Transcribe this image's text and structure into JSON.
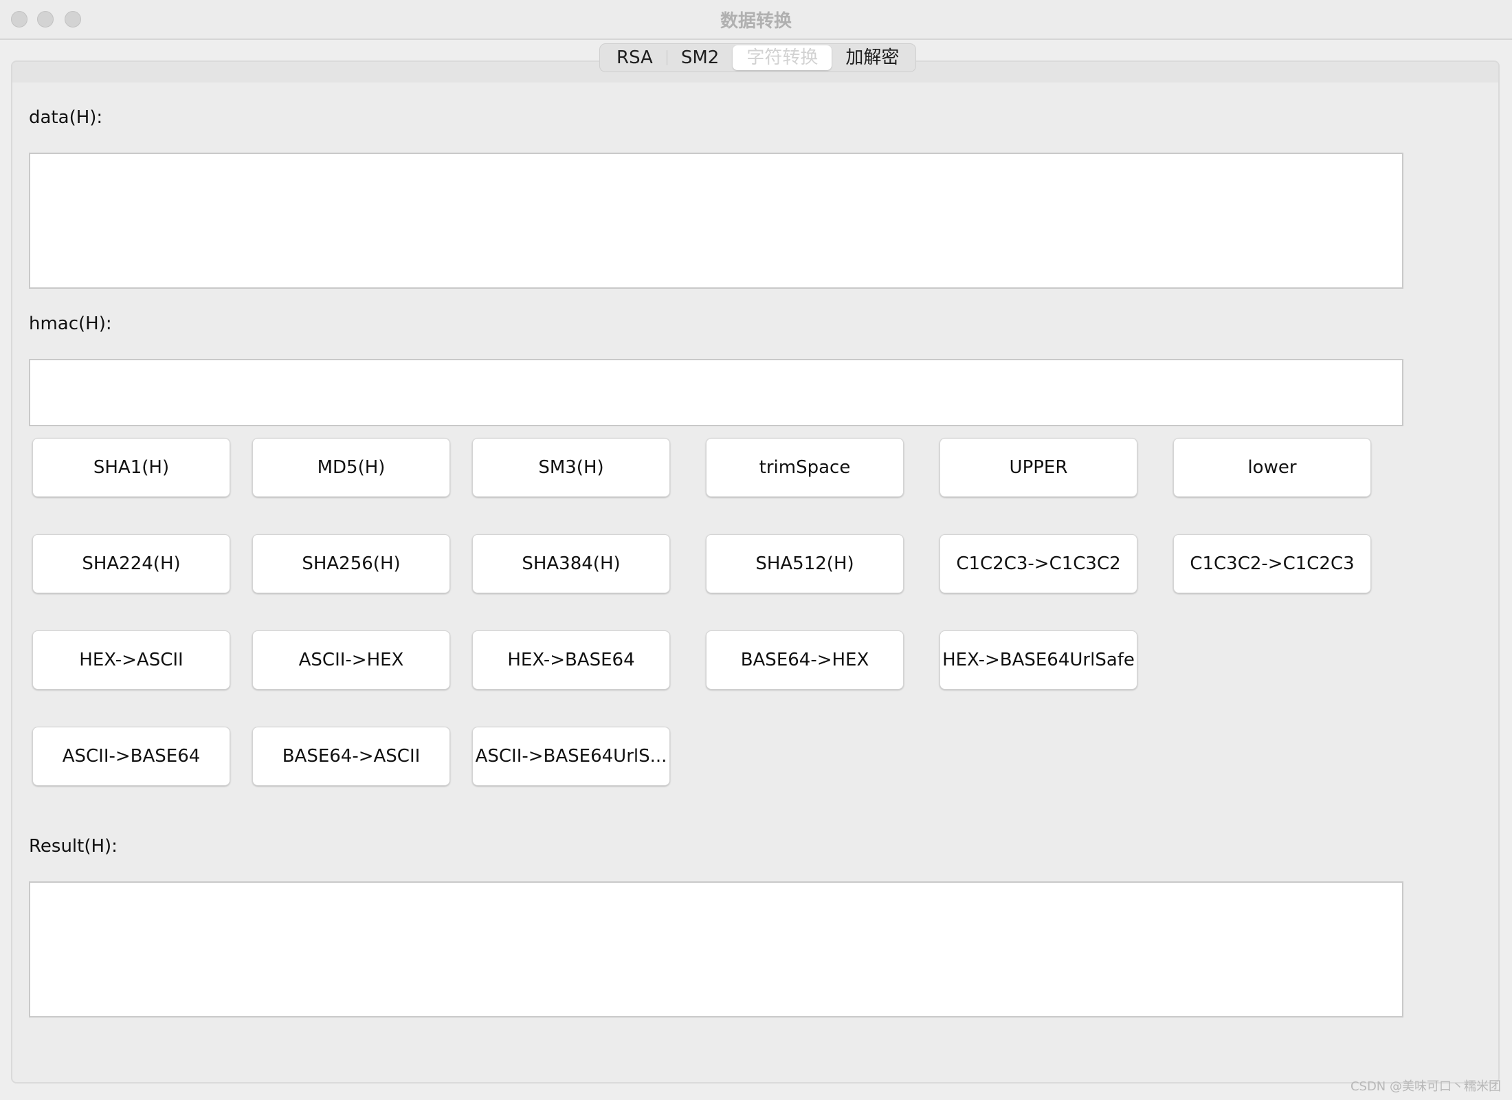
{
  "window": {
    "title": "数据转换"
  },
  "tabs": [
    {
      "label": "RSA",
      "selected": false
    },
    {
      "label": "SM2",
      "selected": false
    },
    {
      "label": "字符转换",
      "selected": true
    },
    {
      "label": "加解密",
      "selected": false
    }
  ],
  "fields": {
    "data_label": "data(H):",
    "data_value": "",
    "hmac_label": "hmac(H):",
    "hmac_value": "",
    "result_label": "Result(H):",
    "result_value": ""
  },
  "buttons": {
    "row1": [
      "SHA1(H)",
      "MD5(H)",
      "SM3(H)",
      "trimSpace",
      "UPPER",
      "lower"
    ],
    "row2": [
      "SHA224(H)",
      "SHA256(H)",
      "SHA384(H)",
      "SHA512(H)",
      "C1C2C3->C1C3C2",
      "C1C3C2->C1C2C3"
    ],
    "row3": [
      "HEX->ASCII",
      "ASCII->HEX",
      "HEX->BASE64",
      "BASE64->HEX",
      "HEX->BASE64UrlSafe"
    ],
    "row4": [
      "ASCII->BASE64",
      "BASE64->ASCII",
      "ASCII->BASE64UrlS..."
    ]
  },
  "watermark": "CSDN @美味可口丶糯米团"
}
